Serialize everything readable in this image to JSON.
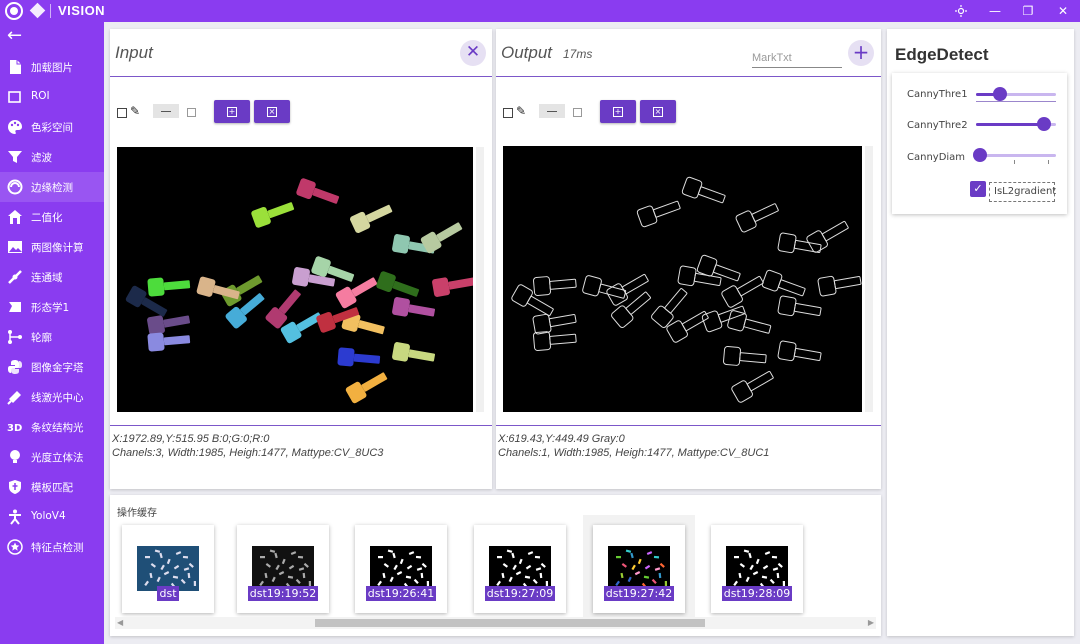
{
  "app": {
    "title": "VISION"
  },
  "window_controls": {
    "theme_icon": "sun-icon",
    "minimize": "—",
    "restore": "❐",
    "close": "✕"
  },
  "sidebar": {
    "back_icon": "arrow-left-icon",
    "items": [
      {
        "label": "加载图片",
        "icon": "file-icon"
      },
      {
        "label": "ROI",
        "icon": "square-icon"
      },
      {
        "label": "色彩空间",
        "icon": "palette-icon"
      },
      {
        "label": "滤波",
        "icon": "filter-icon"
      },
      {
        "label": "边缘检测",
        "icon": "edge-icon",
        "active": true
      },
      {
        "label": "二值化",
        "icon": "home-icon"
      },
      {
        "label": "两图像计算",
        "icon": "image-icon"
      },
      {
        "label": "连通域",
        "icon": "connect-icon"
      },
      {
        "label": "形态学1",
        "icon": "shape-icon"
      },
      {
        "label": "轮廓",
        "icon": "contour-icon"
      },
      {
        "label": "图像金字塔",
        "icon": "python-icon"
      },
      {
        "label": "线激光中心",
        "icon": "laser-icon"
      },
      {
        "label": "条纹结构光",
        "icon": "3d-icon"
      },
      {
        "label": "光度立体法",
        "icon": "bulb-icon"
      },
      {
        "label": "模板匹配",
        "icon": "shield-icon"
      },
      {
        "label": "YoloV4",
        "icon": "person-icon"
      },
      {
        "label": "特征点检测",
        "icon": "star-icon"
      }
    ]
  },
  "input_panel": {
    "title": "Input",
    "info_line1": "X:1972.89,Y:515.95    B:0;G:0;R:0",
    "info_line2": "Chanels:3, Width:1985, Heigh:1477, Mattype:CV_8UC3"
  },
  "output_panel": {
    "title": "Output",
    "time": "17ms",
    "marktxt_placeholder": "MarkTxt",
    "add_label": "+",
    "info_line1": "X:619.43,Y:449.49     Gray:0",
    "info_line2": "Chanels:1, Width:1985, Heigh:1477, Mattype:CV_8UC1"
  },
  "params": {
    "title": "EdgeDetect",
    "sliders": [
      {
        "label": "CannyThre1",
        "value": 0.3
      },
      {
        "label": "CannyThre2",
        "value": 0.85
      },
      {
        "label": "CannyDiam",
        "value": 0.05
      }
    ],
    "checkbox": {
      "label": "IsL2gradient",
      "checked": true
    }
  },
  "cache": {
    "title": "操作缓存",
    "items": [
      {
        "label": "dst",
        "style": "color-bg"
      },
      {
        "label": "dst19:19:52",
        "style": "gray"
      },
      {
        "label": "dst19:26:41",
        "style": "binary"
      },
      {
        "label": "dst19:27:09",
        "style": "binary"
      },
      {
        "label": "dst19:27:42",
        "style": "colored"
      },
      {
        "label": "dst19:28:09",
        "style": "binary"
      }
    ]
  },
  "colors": {
    "accent": "#8a3cf0",
    "button": "#6a3bc5"
  }
}
